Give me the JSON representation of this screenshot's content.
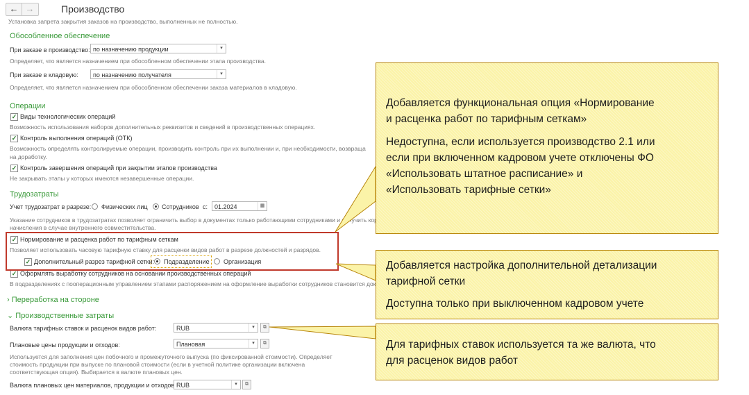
{
  "nav": {
    "back_icon": "←",
    "forward_icon": "→"
  },
  "title": "Производство",
  "intro_hint": "Установка запрета закрытия заказов на производство, выполненных не полностью.",
  "separate_supply": {
    "heading": "Обособленное обеспечение",
    "production_order_label": "При заказе в производство:",
    "production_order_value": "по назначению продукции",
    "production_order_hint": "Определяет, что является назначением при обособленном обеспечении этапа производства.",
    "warehouse_order_label": "При заказе в кладовую:",
    "warehouse_order_value": "по назначению получателя",
    "warehouse_order_hint": "Определяет, что является назначением при обособленном обеспечении заказа материалов в кладовую."
  },
  "operations": {
    "heading": "Операции",
    "tech_ops_label": "Виды технологических операций",
    "tech_ops_hint": "Возможность использования наборов дополнительных реквизитов и сведений в производственных операциях.",
    "qc_label": "Контроль выполнения операций (ОТК)",
    "qc_hint_1": "Возможность определять контролируемые операции, производить контроль при их выполнении и, при необходимости, возвраща",
    "qc_hint_2": "на доработку.",
    "completion_label": "Контроль завершения операций при закрытии этапов производства",
    "completion_hint": "Не закрывать этапы у которых имеются незавершенные операции."
  },
  "labor": {
    "heading": "Трудозатраты",
    "accounting_label": "Учет трудозатрат в разрезе:",
    "radio_individuals": "Физических лиц",
    "radio_employees": "Сотрудников",
    "from_label": "с:",
    "date_value": "01.2024",
    "hint_1": "Указание сотрудников в трудозатратах позволяет ограничить выбор в документах только работающими сотрудниками и получить корректные",
    "hint_2": "начисления в случае внутреннего совместительства.",
    "rating_label": "Нормирование и расценка работ по тарифным сеткам",
    "rating_hint": "Позволяет использовать часовую тарифную ставку для расценки видов работ в разрезе должностей и разрядов.",
    "extra_cut_label": "Дополнительный разрез тарифной сетки:",
    "radio_division": "Подразделение",
    "radio_organization": "Организация",
    "register_label": "Оформлять выработку сотрудников на основании производственных операций",
    "register_hint": "В подразделениях с пооперационным управлением этапами распоряжением на оформление выработки сотрудников становится документ «Производственная операция»"
  },
  "outsourcing": {
    "heading": "Переработка на стороне"
  },
  "costs": {
    "heading": "Производственные затраты",
    "currency_label": "Валюта тарифных ставок и расценок видов работ:",
    "currency_value": "RUB",
    "plan_prices_label": "Плановые цены продукции и отходов:",
    "plan_prices_value": "Плановая",
    "plan_prices_hint_1": "Используется для заполнения цен побочного и промежуточного выпуска (по фиксированной стоимости). Определяет",
    "plan_prices_hint_2": "стоимость продукции при выпуске по плановой стоимости (если в учетной политике организации включена",
    "plan_prices_hint_3": "соответствующая опция). Выбирается в валюте плановых цен.",
    "plan_currency_label": "Валюта плановых цен материалов, продукции и отходов:",
    "plan_currency_value": "RUB"
  },
  "callouts": {
    "c1_p1_l1": "Добавляется функциональная опция «Нормирование",
    "c1_p1_l2": "и расценка работ по тарифным сеткам»",
    "c1_p2_l1": "Недоступна, если используется производство 2.1 или",
    "c1_p2_l2": "если при включенном кадровом учете отключены ФО",
    "c1_p2_l3": "«Использовать штатное расписание» и",
    "c1_p2_l4": "«Использовать тарифные сетки»",
    "c2_p1_l1": "Добавляется настройка дополнительной детализации",
    "c2_p1_l2": "тарифной сетки",
    "c2_p2_l1": "Доступна только при выключенном кадровом учете",
    "c3_l1": "Для тарифных ставок используется та же валюта, что",
    "c3_l2": "для расценок видов работ"
  },
  "colors": {
    "section_green": "#3a9a3a",
    "highlight_red": "#c0392b",
    "callout_fill": "#fbf3a8"
  }
}
